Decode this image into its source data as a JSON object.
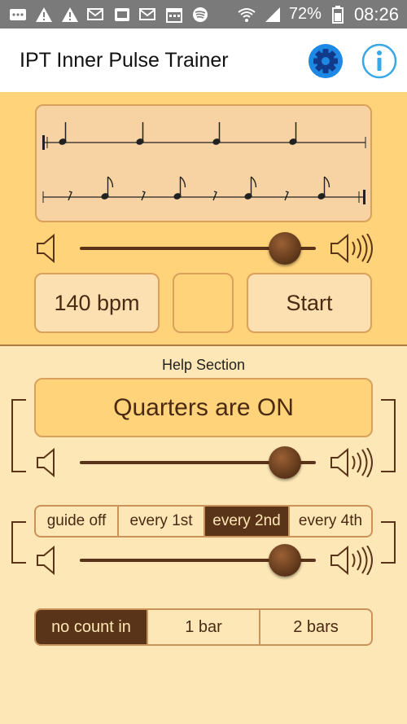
{
  "status_bar": {
    "battery": "72%",
    "time": "08:26",
    "icons": [
      "messages-icon",
      "warning-icon",
      "warning-icon",
      "email-icon",
      "gallery-icon",
      "email-icon",
      "calendar-icon",
      "spotify-icon",
      "wifi-icon",
      "signal-icon",
      "battery-icon"
    ]
  },
  "app_bar": {
    "title": "IPT Inner Pulse Trainer",
    "settings_icon": "gear-icon",
    "info_icon": "info-icon",
    "accent_color": "#1e88e5"
  },
  "top_panel": {
    "tempo_label": "140 bpm",
    "start_label": "Start",
    "blank_button_label": "",
    "volume_level": 0.87
  },
  "help": {
    "section_title": "Help Section",
    "quarters_label": "Quarters are ON",
    "quarters_volume_level": 0.87,
    "guide_options": [
      "guide off",
      "every 1st",
      "every 2nd",
      "every 4th"
    ],
    "guide_selected": "every 2nd",
    "guide_volume_level": 0.87,
    "count_in_options": [
      "no count in",
      "1 bar",
      "2 bars"
    ],
    "count_in_selected": "no count in"
  },
  "colors": {
    "top_panel_bg": "#ffd37a",
    "page_bg": "#fde7b6",
    "dark_brown": "#5a3418",
    "border_tan": "#d9a15c"
  }
}
